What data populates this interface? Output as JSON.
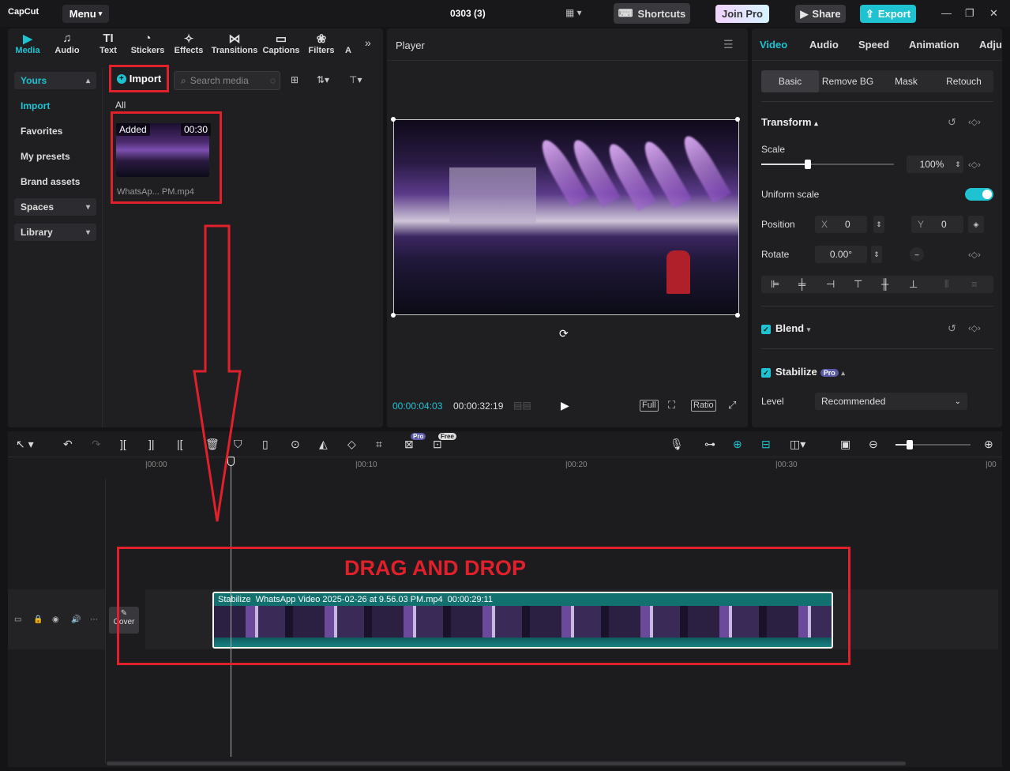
{
  "titlebar": {
    "logo": "CapCut",
    "menu_label": "Menu",
    "project_title": "0303 (3)",
    "shortcuts_label": "Shortcuts",
    "join_pro_label": "Join Pro",
    "share_label": "Share",
    "export_label": "Export"
  },
  "media_tabs": [
    {
      "label": "Media",
      "icon": "media-icon"
    },
    {
      "label": "Audio",
      "icon": "audio-icon"
    },
    {
      "label": "Text",
      "icon": "text-icon"
    },
    {
      "label": "Stickers",
      "icon": "stickers-icon"
    },
    {
      "label": "Effects",
      "icon": "effects-icon"
    },
    {
      "label": "Transitions",
      "icon": "transitions-icon"
    },
    {
      "label": "Captions",
      "icon": "captions-icon"
    },
    {
      "label": "Filters",
      "icon": "filters-icon"
    },
    {
      "label": "A",
      "icon": ""
    }
  ],
  "media_sidebar": {
    "yours": "Yours",
    "import": "Import",
    "favorites": "Favorites",
    "my_presets": "My presets",
    "brand_assets": "Brand assets",
    "spaces": "Spaces",
    "library": "Library"
  },
  "media_toolbar": {
    "import_label": "Import",
    "search_placeholder": "Search media"
  },
  "media_grid": {
    "filter_label": "All",
    "item": {
      "badge": "Added",
      "duration": "00:30",
      "name": "WhatsAp... PM.mp4"
    }
  },
  "player": {
    "title": "Player",
    "time_current": "00:00:04:03",
    "time_total": "00:00:32:19",
    "full_label": "Full",
    "ratio_label": "Ratio"
  },
  "props": {
    "tabs": [
      "Video",
      "Audio",
      "Speed",
      "Animation",
      "Adju"
    ],
    "subtabs": [
      "Basic",
      "Remove BG",
      "Mask",
      "Retouch"
    ],
    "transform_title": "Transform",
    "scale_label": "Scale",
    "scale_value": "100%",
    "scale_slider": 0.35,
    "uniform_scale_label": "Uniform scale",
    "position_label": "Position",
    "pos_x_label": "X",
    "pos_x_value": "0",
    "pos_y_label": "Y",
    "pos_y_value": "0",
    "rotate_label": "Rotate",
    "rotate_value": "0.00°",
    "blend_title": "Blend",
    "stabilize_title": "Stabilize",
    "pro_badge": "Pro",
    "level_label": "Level",
    "level_value": "Recommended"
  },
  "timeline": {
    "ruler": [
      "|00:00",
      "|00:10",
      "|00:20",
      "|00:30",
      "|00"
    ],
    "pro_tag": "Pro",
    "free_tag": "Free",
    "cover_label": "Cover",
    "clip_stabilize": "Stabilize",
    "clip_name": "WhatsApp Video 2025-02-26 at 9.56.03 PM.mp4",
    "clip_duration": "00:00:29:11"
  },
  "annotation": {
    "drag_text": "DRAG AND DROP",
    "color": "#e0202a"
  },
  "colors": {
    "accent": "#1ec2d1"
  }
}
